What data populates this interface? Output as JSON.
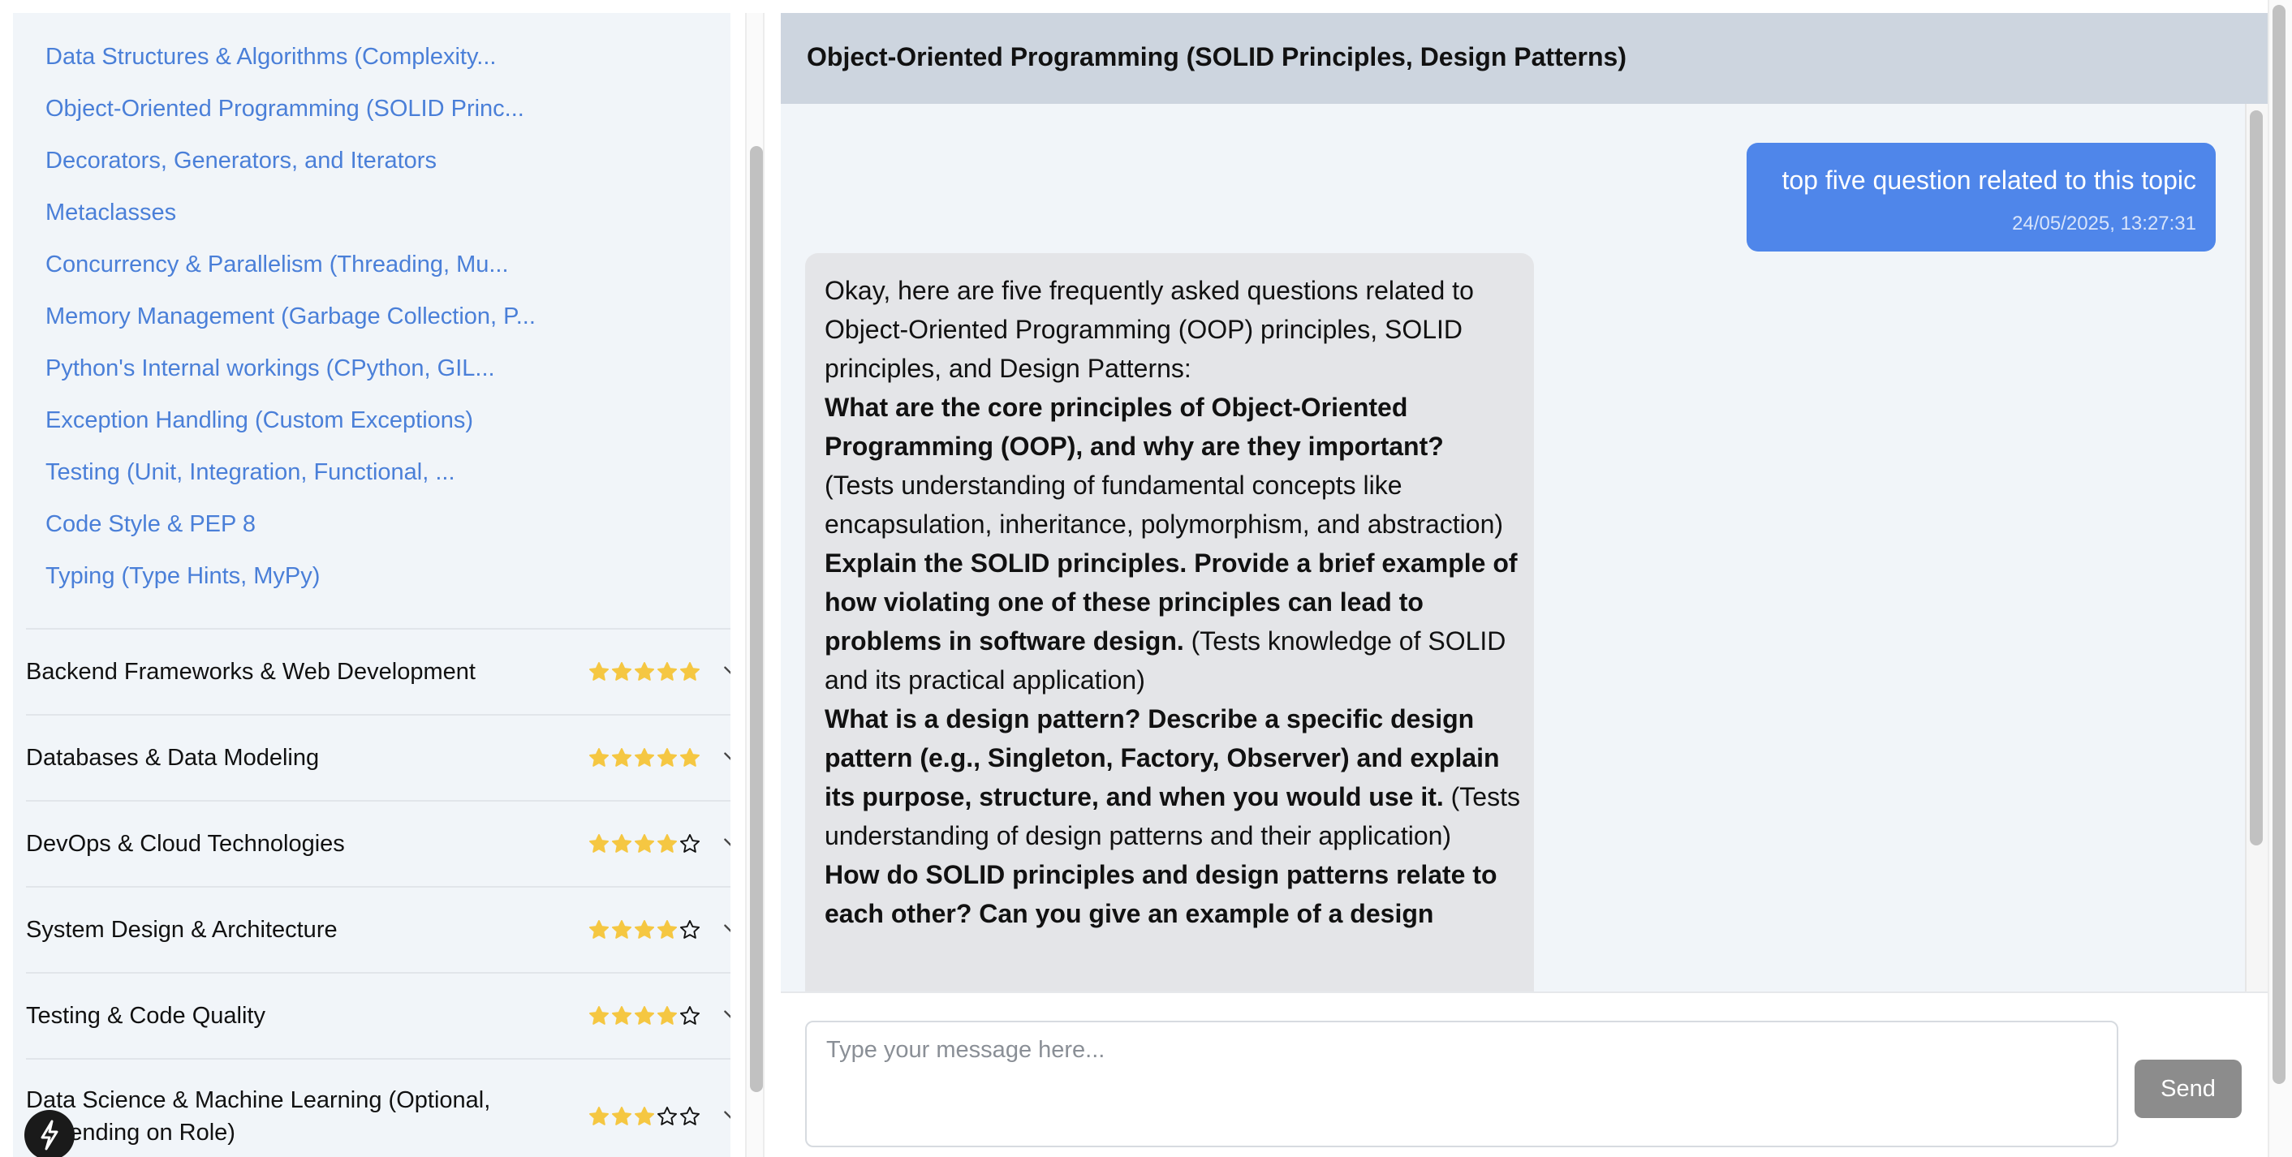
{
  "sidebar": {
    "subtopics": [
      "Data Structures & Algorithms (Complexity...",
      "Object-Oriented Programming (SOLID Princ...",
      "Decorators, Generators, and Iterators",
      "Metaclasses",
      "Concurrency & Parallelism (Threading, Mu...",
      "Memory Management (Garbage Collection, P...",
      "Python's Internal workings (CPython, GIL...",
      "Exception Handling (Custom Exceptions)",
      "Testing (Unit, Integration, Functional, ...",
      "Code Style & PEP 8",
      "Typing (Type Hints, MyPy)"
    ],
    "categories": [
      {
        "name": "Backend Frameworks & Web Development",
        "rating": 5
      },
      {
        "name": "Databases & Data Modeling",
        "rating": 5
      },
      {
        "name": "DevOps & Cloud Technologies",
        "rating": 4
      },
      {
        "name": "System Design & Architecture",
        "rating": 4
      },
      {
        "name": "Testing & Code Quality",
        "rating": 4
      },
      {
        "name": "Data Science & Machine Learning (Optional, Depending on Role)",
        "rating": 3
      }
    ],
    "rating_max": 5,
    "icons": {
      "expand": "chevron-down-icon",
      "star_filled": "star-filled-icon",
      "star_empty": "star-outline-icon",
      "logo": "bolt-icon"
    }
  },
  "chat": {
    "title": "Object-Oriented Programming (SOLID Principles, Design Patterns)",
    "user_message": {
      "text": "top five question related to this topic",
      "timestamp": "24/05/2025, 13:27:31"
    },
    "bot_message": {
      "intro": "Okay, here are five frequently asked questions related to Object-Oriented Programming (OOP) principles, SOLID principles, and Design Patterns:",
      "q1_bold": "What are the core principles of Object-Oriented Programming (OOP), and why are they important?",
      "q1_note": "(Tests understanding of fundamental concepts like encapsulation, inheritance, polymorphism, and abstraction)",
      "q2_bold": "Explain the SOLID principles. Provide a brief example of how violating one of these principles can lead to problems in software design.",
      "q2_note": "(Tests knowledge of SOLID and its practical application)",
      "q3_bold": "What is a design pattern? Describe a specific design pattern (e.g., Singleton, Factory, Observer) and explain its purpose, structure, and when you would use it.",
      "q3_note": "(Tests understanding of design patterns and their application)",
      "q4_bold": "How do SOLID principles and design patterns relate to each other? Can you give an example of a design"
    },
    "composer": {
      "placeholder": "Type your message here...",
      "send_label": "Send"
    }
  },
  "colors": {
    "link": "#4a7fd8",
    "star": "#f5c742",
    "user_bubble": "#4f86ea",
    "bot_bubble": "#e4e5e8",
    "header": "#cdd5df",
    "send_button": "#8c8c8c"
  }
}
